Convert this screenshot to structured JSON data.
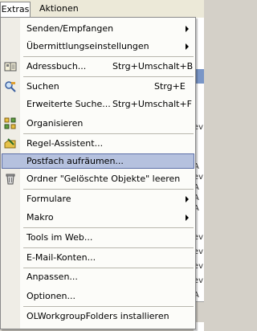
{
  "menubar": {
    "extras": "Extras",
    "aktionen": "Aktionen"
  },
  "menu": {
    "items": [
      {
        "label": "Senden/Empfangen",
        "submenu": true
      },
      {
        "label": "Übermittlungseinstellungen",
        "submenu": true
      },
      {
        "label": "Adressbuch...",
        "shortcut": "Strg+Umschalt+B",
        "icon": "address-book-icon"
      },
      {
        "label": "Suchen",
        "shortcut": "Strg+E",
        "icon": "search-icon"
      },
      {
        "label": "Erweiterte Suche...",
        "shortcut": "Strg+Umschalt+F"
      },
      {
        "label": "Organisieren",
        "icon": "organize-icon"
      },
      {
        "label": "Regel-Assistent...",
        "icon": "rules-wizard-icon"
      },
      {
        "label": "Postfach aufräumen...",
        "highlighted": true
      },
      {
        "label": "Ordner \"Gelöschte Objekte\" leeren",
        "icon": "empty-trash-icon"
      },
      {
        "label": "Formulare",
        "submenu": true
      },
      {
        "label": "Makro",
        "submenu": true
      },
      {
        "label": "Tools im Web..."
      },
      {
        "label": "E-Mail-Konten..."
      },
      {
        "label": "Anpassen..."
      },
      {
        "label": "Optionen..."
      },
      {
        "label": "OLWorkgroupFolders installieren"
      }
    ]
  },
  "background": {
    "rows": [
      "ev",
      "A",
      "ev",
      "A",
      "A",
      "A",
      "ev",
      "ev",
      "ev",
      "ev",
      "A"
    ]
  },
  "colors": {
    "highlight": "#b5c1de",
    "highlight_border": "#5c6fa8"
  }
}
